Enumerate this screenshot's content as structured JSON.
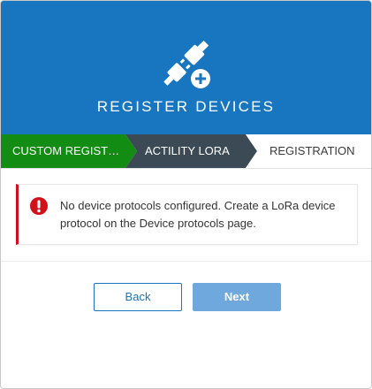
{
  "header": {
    "title": "REGISTER DEVICES",
    "icon": "plug-add-icon",
    "background_color": "#1776bf"
  },
  "steps": [
    {
      "label": "CUSTOM REGIST…",
      "state": "completed",
      "color": "#138c13"
    },
    {
      "label": "ACTILITY LORA",
      "state": "completed",
      "color": "#3b4a55"
    },
    {
      "label": "REGISTRATION",
      "state": "current",
      "color": "#ffffff"
    }
  ],
  "alert": {
    "icon": "error-circle-icon",
    "message": "No device protocols configured. Create a LoRa device protocol on the Device protocols page.",
    "color": "#d0101b"
  },
  "buttons": {
    "back_label": "Back",
    "next_label": "Next",
    "next_disabled": true
  }
}
